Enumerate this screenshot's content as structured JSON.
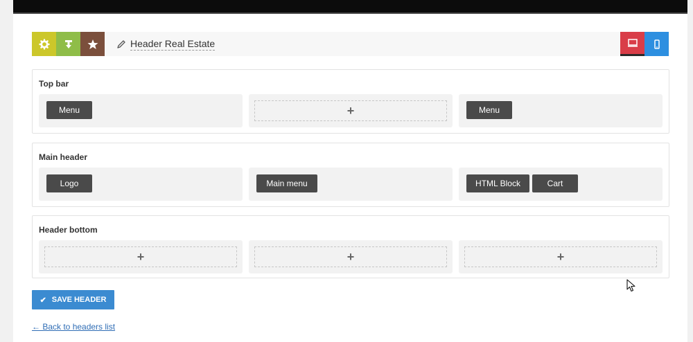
{
  "toolbar": {
    "title": "Header Real Estate",
    "buttons": {
      "settings_icon": "gear-icon",
      "import_icon": "import-icon",
      "preset_icon": "star-icon",
      "desktop_icon": "desktop-icon",
      "mobile_icon": "mobile-icon"
    },
    "colors": {
      "settings": "#ccc72a",
      "import": "#8fbd48",
      "preset": "#7b4f3c",
      "desktop": "#d93d48",
      "mobile": "#2d8fe0"
    }
  },
  "sections": {
    "top_bar": {
      "label": "Top bar",
      "left": [
        "Menu"
      ],
      "right": [
        "Menu"
      ]
    },
    "main_header": {
      "label": "Main header",
      "left": [
        "Logo"
      ],
      "center": [
        "Main menu"
      ],
      "right": [
        "HTML Block",
        "Cart"
      ]
    },
    "header_bottom": {
      "label": "Header bottom"
    },
    "add_symbol": "+"
  },
  "actions": {
    "save_label": "SAVE HEADER",
    "save_check": "✔",
    "back_link": "← Back to headers list"
  }
}
